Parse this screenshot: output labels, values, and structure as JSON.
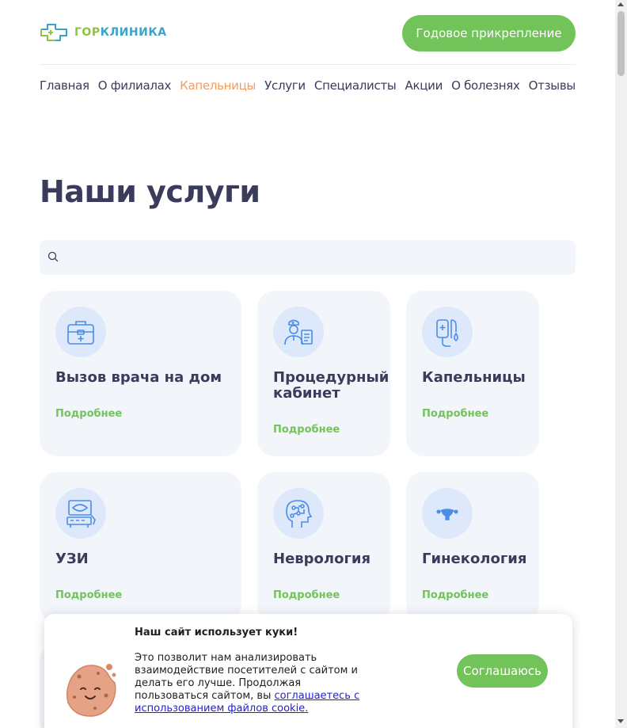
{
  "header": {
    "logo_part1": "ГОР",
    "logo_part2": "КЛИНИКА",
    "cta_label": "Годовое прикрепление"
  },
  "nav": {
    "items": [
      {
        "label": "Главная",
        "active": false
      },
      {
        "label": "О филиалах",
        "active": false
      },
      {
        "label": "Капельницы",
        "active": true
      },
      {
        "label": "Услуги",
        "active": false
      },
      {
        "label": "Специалисты",
        "active": false
      },
      {
        "label": "Акции",
        "active": false
      },
      {
        "label": "О болезнях",
        "active": false
      },
      {
        "label": "Отзывы",
        "active": false
      }
    ]
  },
  "main": {
    "title": "Наши услуги",
    "search": {
      "value": "",
      "placeholder": ""
    },
    "more_label": "Подробнее",
    "cards": [
      {
        "title": "Вызов врача на дом",
        "icon": "medical-kit-icon"
      },
      {
        "title": "Процедурный кабинет",
        "icon": "nurse-icon"
      },
      {
        "title": "Капельницы",
        "icon": "iv-drip-icon"
      },
      {
        "title": "УЗИ",
        "icon": "ultrasound-icon"
      },
      {
        "title": "Неврология",
        "icon": "brain-head-icon"
      },
      {
        "title": "Гинекология",
        "icon": "uterus-icon"
      }
    ]
  },
  "cookie": {
    "title": "Наш сайт использует куки!",
    "text": "Это позволит нам анализировать взаимодействие посетителей с сайтом и делать его лучше. Продолжая пользоваться сайтом, вы ",
    "link": "соглашаетесь с использованием файлов cookie.",
    "agree_label": "Соглашаюсь"
  },
  "colors": {
    "accent_green": "#72c35a",
    "active_nav": "#f29d62",
    "text_dark": "#3b3b5c",
    "card_bg": "#f2f6fb",
    "icon_blue": "#4a8de6"
  }
}
